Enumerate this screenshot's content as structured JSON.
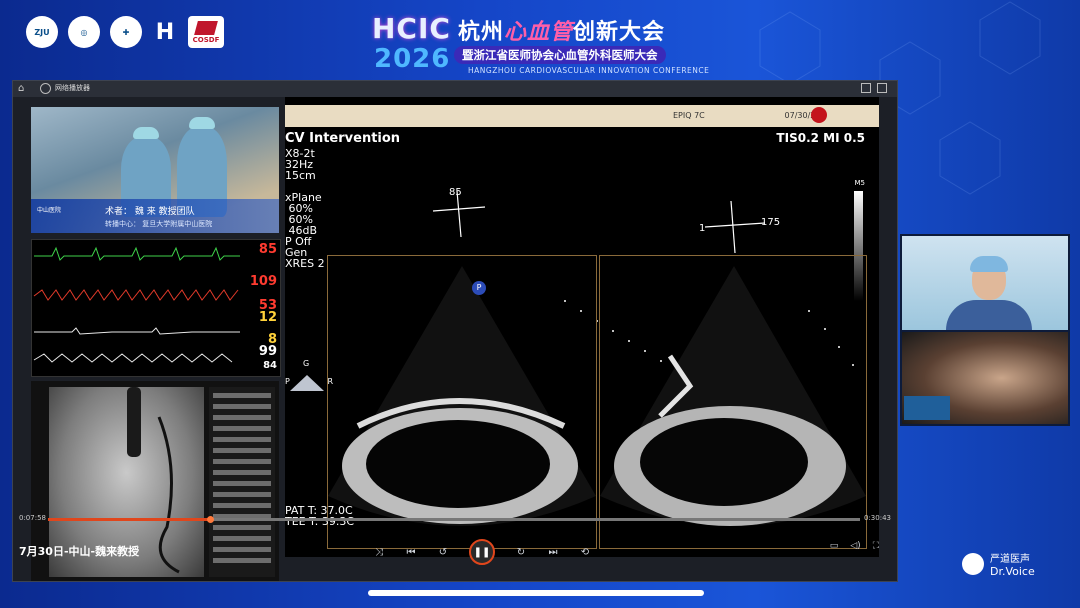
{
  "banner": {
    "hcic": "HCIC",
    "year": "2026",
    "cn_prefix": "杭州",
    "cn_mid": "心血管",
    "cn_suffix": "创新大会",
    "subtitle_cn": "暨浙江省医师协会心血管外科医师大会",
    "subtitle_en": "HANGZHOU CARDIOVASCULAR INNOVATION CONFERENCE",
    "logo_last": "COSDF"
  },
  "player": {
    "window_title": "网络播放器",
    "current_time": "0:07:58",
    "total_time": "0:30:43",
    "progress_fraction": 0.2,
    "caption": "7月30日-中山-魏来教授"
  },
  "camera": {
    "line1": "术者：  魏 来  教授团队",
    "line2": "转播中心：  复旦大学附属中山医院",
    "tag": "中山医院"
  },
  "vitals": [
    "85",
    "109",
    "53",
    "12",
    "8",
    "99",
    "84"
  ],
  "echo": {
    "device": "EPIQ 7C",
    "date": "07/30/2...",
    "mode": "CV Intervention",
    "tis_mi": "TIS0.2   MI 0.5",
    "params": "X8-2t\n32Hz\n15cm\n\nxPlane\n 60%\n 60%\n 46dB\nP Off\nGen\nXRES 2",
    "angle_left": "85",
    "angle_right_1": "1",
    "angle_right_2": "175",
    "scale": "M5",
    "marker": "P",
    "orient_g": "G",
    "orient_p": "P",
    "orient_r": "R",
    "temp": "PAT T: 37.0C\nTEE T: 39.3C"
  },
  "watermark": {
    "line1": "严道医声",
    "line2": "Dr.Voice"
  },
  "colors": {
    "accent": "#e0461c",
    "banner_bg": "#1546c8"
  }
}
